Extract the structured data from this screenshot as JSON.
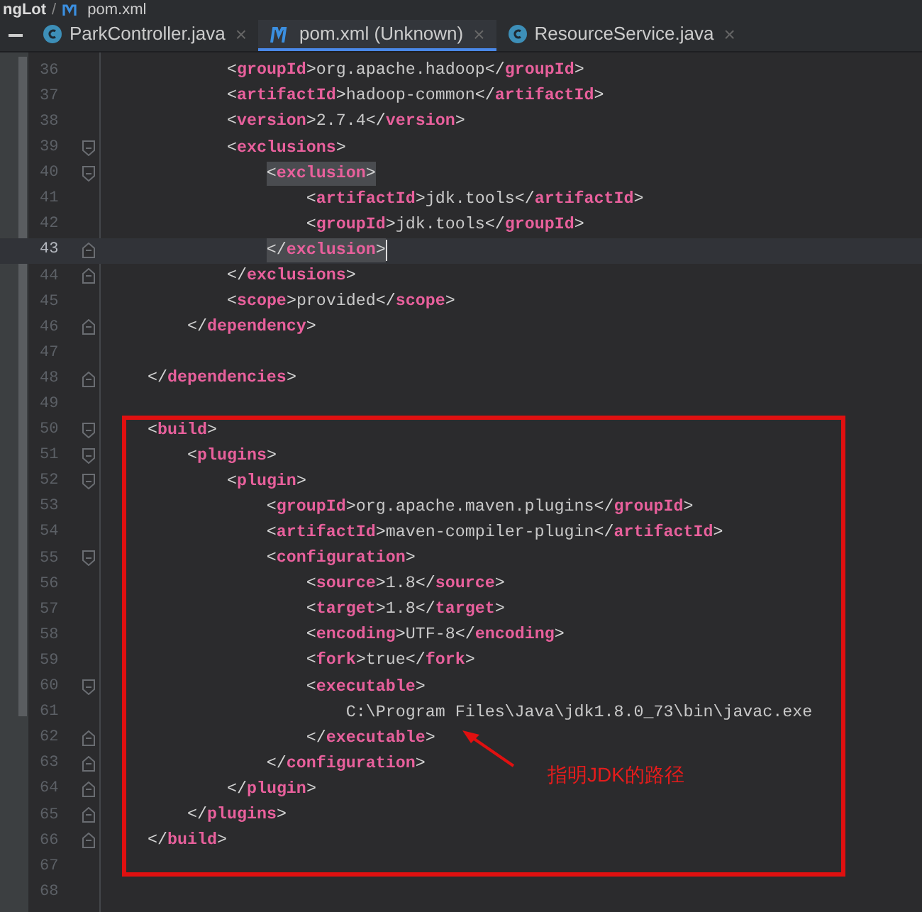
{
  "breadcrumb": {
    "project": "ngLot",
    "separator": "/",
    "file": "pom.xml"
  },
  "tabs": [
    {
      "label": "ParkController.java",
      "kind": "class",
      "selected": false
    },
    {
      "label": "pom.xml (Unknown)",
      "kind": "maven",
      "selected": true
    },
    {
      "label": "ResourceService.java",
      "kind": "class",
      "selected": false
    }
  ],
  "close_glyph": "×",
  "lines": [
    {
      "number": "36",
      "code": "            <groupId>org.apache.hadoop</groupId>",
      "kind": "plain",
      "current": false,
      "highlighted": false
    },
    {
      "number": "37",
      "code": "            <artifactId>hadoop-common</artifactId>",
      "kind": "plain",
      "current": false,
      "highlighted": false
    },
    {
      "number": "38",
      "code": "            <version>2.7.4</version>",
      "kind": "plain",
      "current": false,
      "highlighted": false
    },
    {
      "number": "39",
      "code": "            <exclusions>",
      "kind": "open",
      "current": false,
      "highlighted": false
    },
    {
      "number": "40",
      "code": "                <exclusion>",
      "kind": "open",
      "current": false,
      "highlighted": true
    },
    {
      "number": "41",
      "code": "                    <artifactId>jdk.tools</artifactId>",
      "kind": "plain",
      "current": false,
      "highlighted": false
    },
    {
      "number": "42",
      "code": "                    <groupId>jdk.tools</groupId>",
      "kind": "plain",
      "current": false,
      "highlighted": false
    },
    {
      "number": "43",
      "code": "                </exclusion>",
      "kind": "close",
      "current": true,
      "highlighted": true
    },
    {
      "number": "44",
      "code": "            </exclusions>",
      "kind": "close",
      "current": false,
      "highlighted": false
    },
    {
      "number": "45",
      "code": "            <scope>provided</scope>",
      "kind": "plain",
      "current": false,
      "highlighted": false
    },
    {
      "number": "46",
      "code": "        </dependency>",
      "kind": "close",
      "current": false,
      "highlighted": false
    },
    {
      "number": "47",
      "kind": "plain",
      "current": false
    },
    {
      "number": "48",
      "code": "    </dependencies>",
      "kind": "close",
      "current": false,
      "highlighted": false
    },
    {
      "number": "49",
      "kind": "plain",
      "current": false
    },
    {
      "number": "50",
      "code": "    <build>",
      "kind": "open",
      "current": false,
      "highlighted": false
    },
    {
      "number": "51",
      "code": "        <plugins>",
      "kind": "open",
      "current": false,
      "highlighted": false
    },
    {
      "number": "52",
      "code": "            <plugin>",
      "kind": "open",
      "current": false,
      "highlighted": false
    },
    {
      "number": "53",
      "code": "                <groupId>org.apache.maven.plugins</groupId>",
      "kind": "plain",
      "current": false,
      "highlighted": false
    },
    {
      "number": "54",
      "code": "                <artifactId>maven-compiler-plugin</artifactId>",
      "kind": "plain",
      "current": false,
      "highlighted": false
    },
    {
      "number": "55",
      "code": "                <configuration>",
      "kind": "open",
      "current": false,
      "highlighted": false
    },
    {
      "number": "56",
      "code": "                    <source>1.8</source>",
      "kind": "plain",
      "current": false,
      "highlighted": false
    },
    {
      "number": "57",
      "code": "                    <target>1.8</target>",
      "kind": "plain",
      "current": false,
      "highlighted": false
    },
    {
      "number": "58",
      "code": "                    <encoding>UTF-8</encoding>",
      "kind": "plain",
      "current": false,
      "highlighted": false
    },
    {
      "number": "59",
      "code": "                    <fork>true</fork>",
      "kind": "plain",
      "current": false,
      "highlighted": false
    },
    {
      "number": "60",
      "code": "                    <executable>",
      "kind": "open",
      "current": false,
      "highlighted": false
    },
    {
      "number": "61",
      "code": "                        C:\\Program Files\\Java\\jdk1.8.0_73\\bin\\javac.exe",
      "kind": "plain",
      "current": false,
      "highlighted": false
    },
    {
      "number": "62",
      "code": "                    </executable>",
      "kind": "close",
      "current": false,
      "highlighted": false
    },
    {
      "number": "63",
      "code": "                </configuration>",
      "kind": "close",
      "current": false,
      "highlighted": false
    },
    {
      "number": "64",
      "code": "            </plugin>",
      "kind": "close",
      "current": false,
      "highlighted": false
    },
    {
      "number": "65",
      "code": "        </plugins>",
      "kind": "close",
      "current": false,
      "highlighted": false
    },
    {
      "number": "66",
      "code": "    </build>",
      "kind": "close",
      "current": false,
      "highlighted": false
    },
    {
      "number": "67",
      "kind": "plain",
      "current": false
    },
    {
      "number": "68",
      "kind": "plain",
      "current": false
    }
  ],
  "annotation": {
    "text": "指明JDK的路径"
  }
}
